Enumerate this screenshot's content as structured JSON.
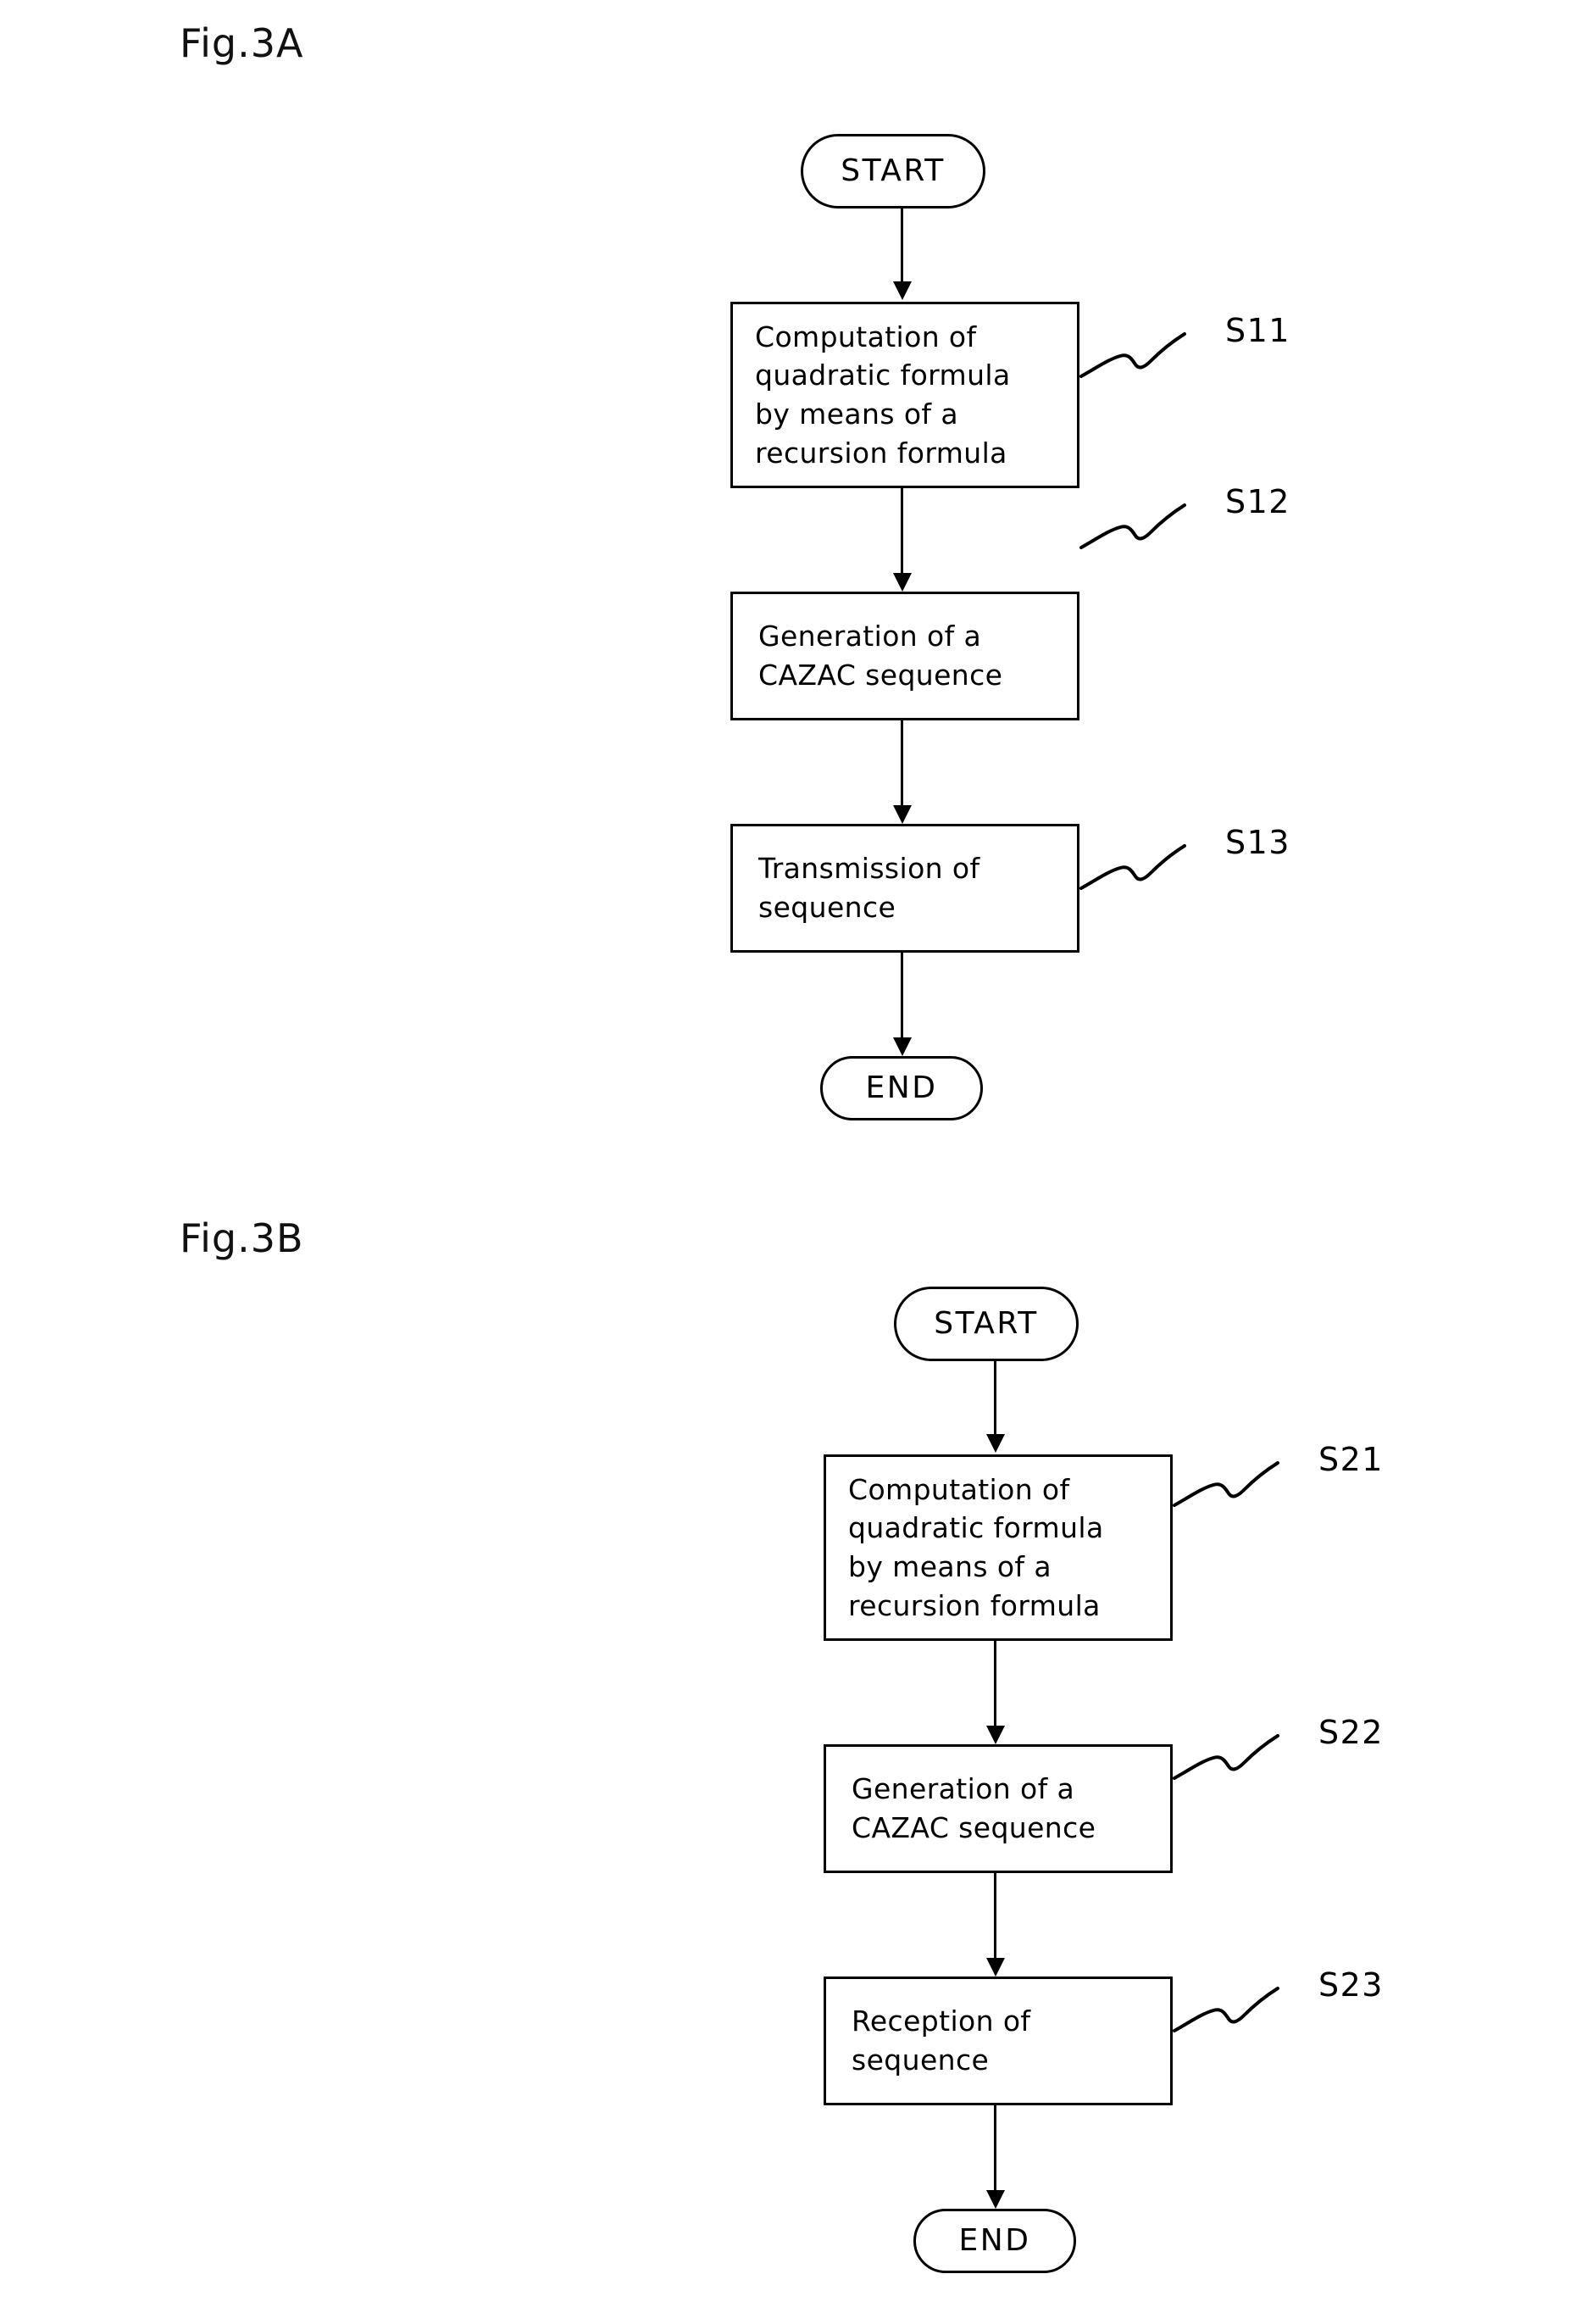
{
  "document": {
    "kind": "patent-flowchart",
    "ink_color": "#000000",
    "background_color": "#ffffff"
  },
  "figures": [
    {
      "id": "fig-a",
      "label": "Fig.3A",
      "nodes": {
        "start": {
          "label": "START",
          "shape": "stadium"
        },
        "end": {
          "label": "END",
          "shape": "stadium"
        },
        "steps": [
          {
            "ref": "S11",
            "text": "Computation of\nquadratic formula\nby means of a\nrecursion formula",
            "lines": [
              "Computation of",
              "quadratic formula",
              "by means of a",
              "recursion formula"
            ]
          },
          {
            "ref": "S12",
            "text": "Generation of a\nCAZAC sequence",
            "lines": [
              "Generation of a",
              "CAZAC sequence"
            ]
          },
          {
            "ref": "S13",
            "text": "Transmission of\nsequence",
            "lines": [
              "Transmission of",
              "sequence"
            ]
          }
        ]
      }
    },
    {
      "id": "fig-b",
      "label": "Fig.3B",
      "nodes": {
        "start": {
          "label": "START",
          "shape": "stadium"
        },
        "end": {
          "label": "END",
          "shape": "stadium"
        },
        "steps": [
          {
            "ref": "S21",
            "text": "Computation of\nquadratic formula\nby means of a\nrecursion formula",
            "lines": [
              "Computation of",
              "quadratic formula",
              "by means of a",
              "recursion formula"
            ]
          },
          {
            "ref": "S22",
            "text": "Generation of a\nCAZAC sequence",
            "lines": [
              "Generation of a",
              "CAZAC sequence"
            ]
          },
          {
            "ref": "S23",
            "text": "Reception of\nsequence",
            "lines": [
              "Reception of",
              "sequence"
            ]
          }
        ]
      }
    }
  ]
}
